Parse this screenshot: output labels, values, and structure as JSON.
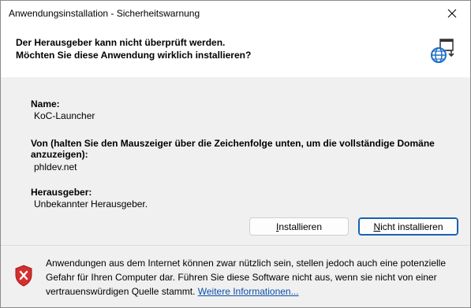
{
  "window": {
    "title": "Anwendungsinstallation - Sicherheitswarnung",
    "close_glyph": "✕"
  },
  "header": {
    "line1": "Der Herausgeber kann nicht überprüft werden.",
    "line2": "Möchten Sie diese Anwendung wirklich installieren?",
    "icon": "globe-install-icon"
  },
  "details": {
    "name_label": "Name:",
    "name_value": "KoC-Launcher",
    "from_label_line1": "Von (halten Sie den Mauszeiger über die Zeichenfolge unten, um die vollständige Domäne",
    "from_label_line2": "anzuzeigen):",
    "from_value": "phldev.net",
    "publisher_label": "Herausgeber:",
    "publisher_value": "Unbekannter Herausgeber."
  },
  "buttons": {
    "install_label": "Installieren",
    "dont_install_label": "Nicht installieren"
  },
  "warning": {
    "icon": "shield-error-icon",
    "line1": "Anwendungen aus dem Internet können zwar nützlich sein, stellen jedoch auch eine potenzielle",
    "line2": "Gefahr für Ihren Computer dar. Führen Sie diese Software nicht aus, wenn sie nicht von einer",
    "line3_prefix": "vertrauenswürdigen Quelle stammt. ",
    "more_info_link": "Weitere Informationen..."
  },
  "colors": {
    "accent": "#1a5fb4",
    "link": "#0a4fa8",
    "shield_red": "#d32f2f"
  }
}
